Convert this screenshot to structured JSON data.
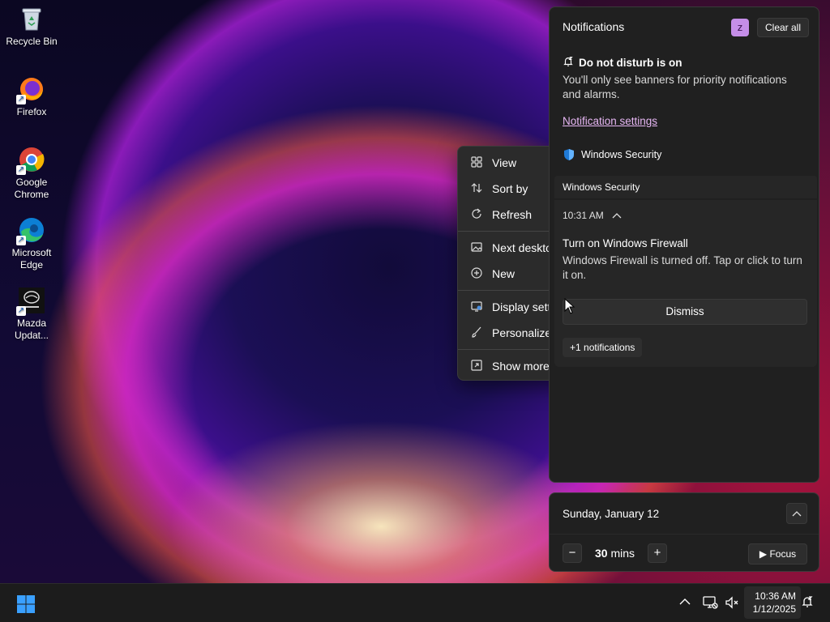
{
  "desktop": {
    "icons": [
      {
        "label": "Recycle Bin",
        "icon": "recycle-bin-icon"
      },
      {
        "label": "Firefox",
        "icon": "firefox-icon"
      },
      {
        "label": "Google Chrome",
        "icon": "chrome-icon"
      },
      {
        "label": "Microsoft Edge",
        "icon": "edge-icon"
      },
      {
        "label": "Mazda Updat...",
        "icon": "mazda-icon"
      }
    ]
  },
  "context_menu": {
    "items": [
      {
        "label": "View",
        "icon": "grid-icon"
      },
      {
        "label": "Sort by",
        "icon": "sort-icon"
      },
      {
        "label": "Refresh",
        "icon": "refresh-icon"
      },
      {
        "label": "Next deskto",
        "icon": "image-icon"
      },
      {
        "label": "New",
        "icon": "plus-circle-icon"
      },
      {
        "label": "Display sett",
        "icon": "display-icon"
      },
      {
        "label": "Personalize",
        "icon": "brush-icon"
      },
      {
        "label": "Show more",
        "icon": "expand-icon"
      }
    ]
  },
  "notifications": {
    "title": "Notifications",
    "clear_all": "Clear all",
    "dnd_title": "Do not disturb is on",
    "dnd_desc": "You'll only see banners for priority notifications and alarms.",
    "settings_link": "Notification settings",
    "app_name": "Windows Security",
    "group_header": "Windows Security",
    "card": {
      "time": "10:31 AM",
      "title": "Turn on Windows Firewall",
      "body": "Windows Firewall is turned off. Tap or click to turn it on.",
      "dismiss": "Dismiss",
      "more": "+1 notifications"
    }
  },
  "calendar": {
    "date": "Sunday, January 12",
    "focus_value": "30",
    "focus_unit": "mins",
    "focus_button": "Focus"
  },
  "taskbar": {
    "time": "10:36 AM",
    "date": "1/12/2025"
  },
  "colors": {
    "accent_link": "#e7b7f4",
    "panel_bg": "#202020",
    "card_bg": "#262626",
    "badge": "#c58ee8"
  }
}
